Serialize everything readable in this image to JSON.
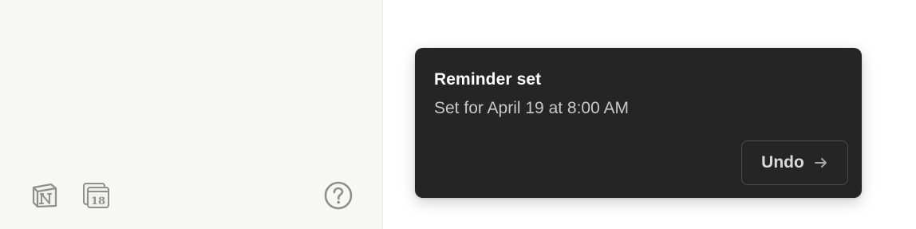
{
  "sidebar": {
    "footer_icons": {
      "notion": "notion-logo-icon",
      "calendar": "calendar-icon",
      "calendar_day": "18",
      "help": "help-icon"
    }
  },
  "toast": {
    "title": "Reminder set",
    "subtitle": "Set for April 19 at 8:00 AM",
    "undo_label": "Undo",
    "arrow_icon": "arrow-right-icon"
  },
  "colors": {
    "sidebar_bg": "#f7f7f5",
    "toast_bg": "#252525",
    "toast_title": "#ffffff",
    "toast_subtitle": "#c8c8c8",
    "icon_gray": "#8f8f8c"
  }
}
